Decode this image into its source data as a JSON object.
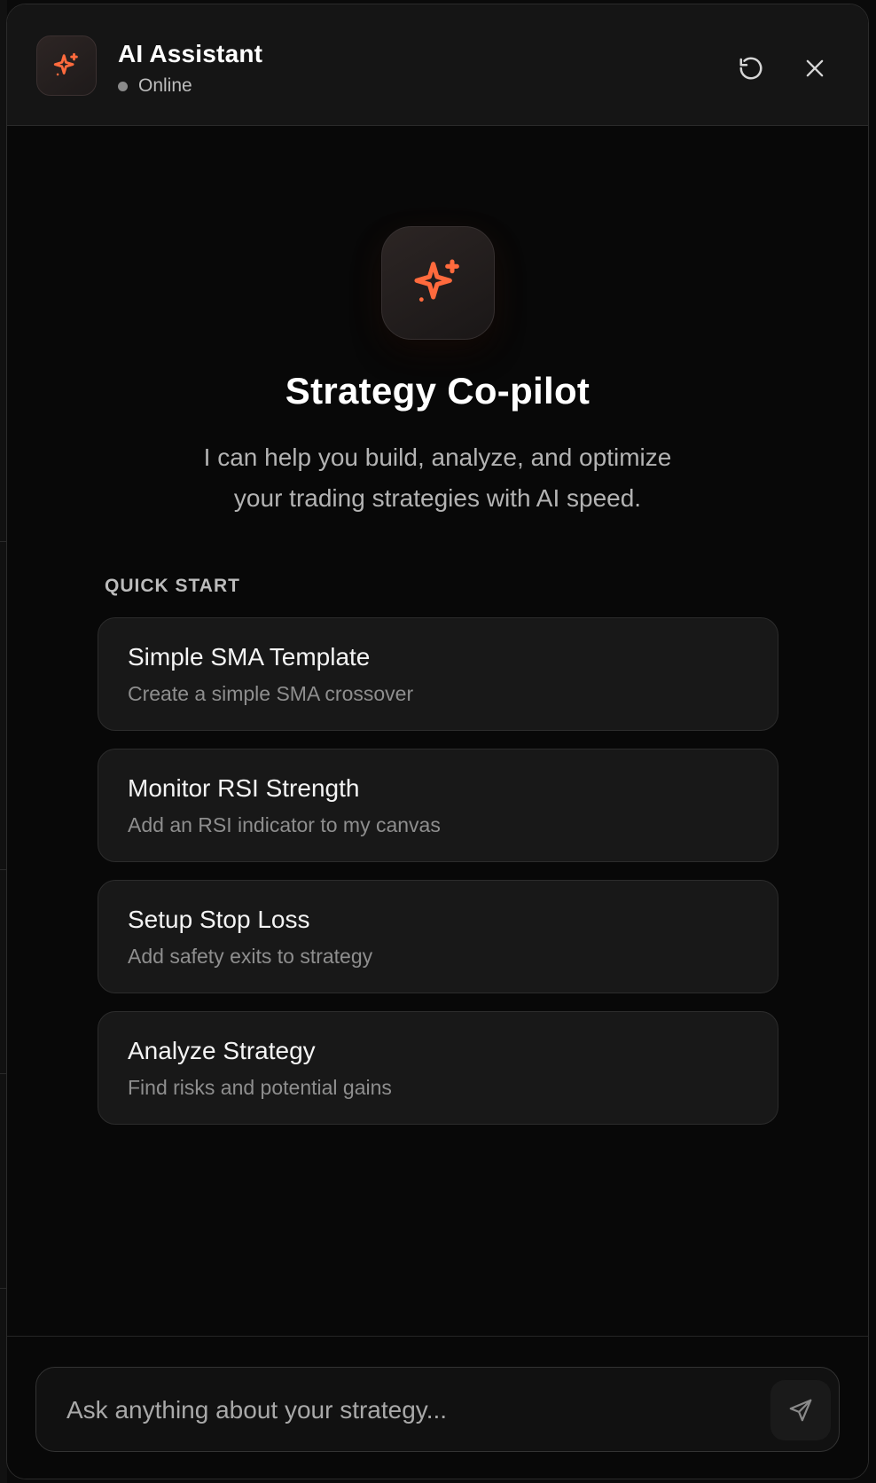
{
  "header": {
    "title": "AI Assistant",
    "status": "Online",
    "avatar_icon": "sparkle-icon",
    "actions": [
      {
        "name": "reset-icon"
      },
      {
        "name": "close-icon"
      }
    ]
  },
  "hero": {
    "icon": "sparkle-icon",
    "title": "Strategy Co-pilot",
    "description_line1": "I can help you build, analyze, and optimize",
    "description_line2": "your trading strategies with AI speed."
  },
  "quick_start": {
    "label": "QUICK START",
    "items": [
      {
        "title": "Simple SMA Template",
        "subtitle": "Create a simple SMA crossover"
      },
      {
        "title": "Monitor RSI Strength",
        "subtitle": "Add an RSI indicator to my canvas"
      },
      {
        "title": "Setup Stop Loss",
        "subtitle": "Add safety exits to strategy"
      },
      {
        "title": "Analyze Strategy",
        "subtitle": "Find risks and potential gains"
      }
    ]
  },
  "composer": {
    "placeholder": "Ask anything about your strategy...",
    "value": "",
    "send_icon": "send-icon"
  },
  "colors": {
    "accent": "#ff6a3d",
    "background": "#080808",
    "card": "#181818",
    "header": "#151515"
  }
}
